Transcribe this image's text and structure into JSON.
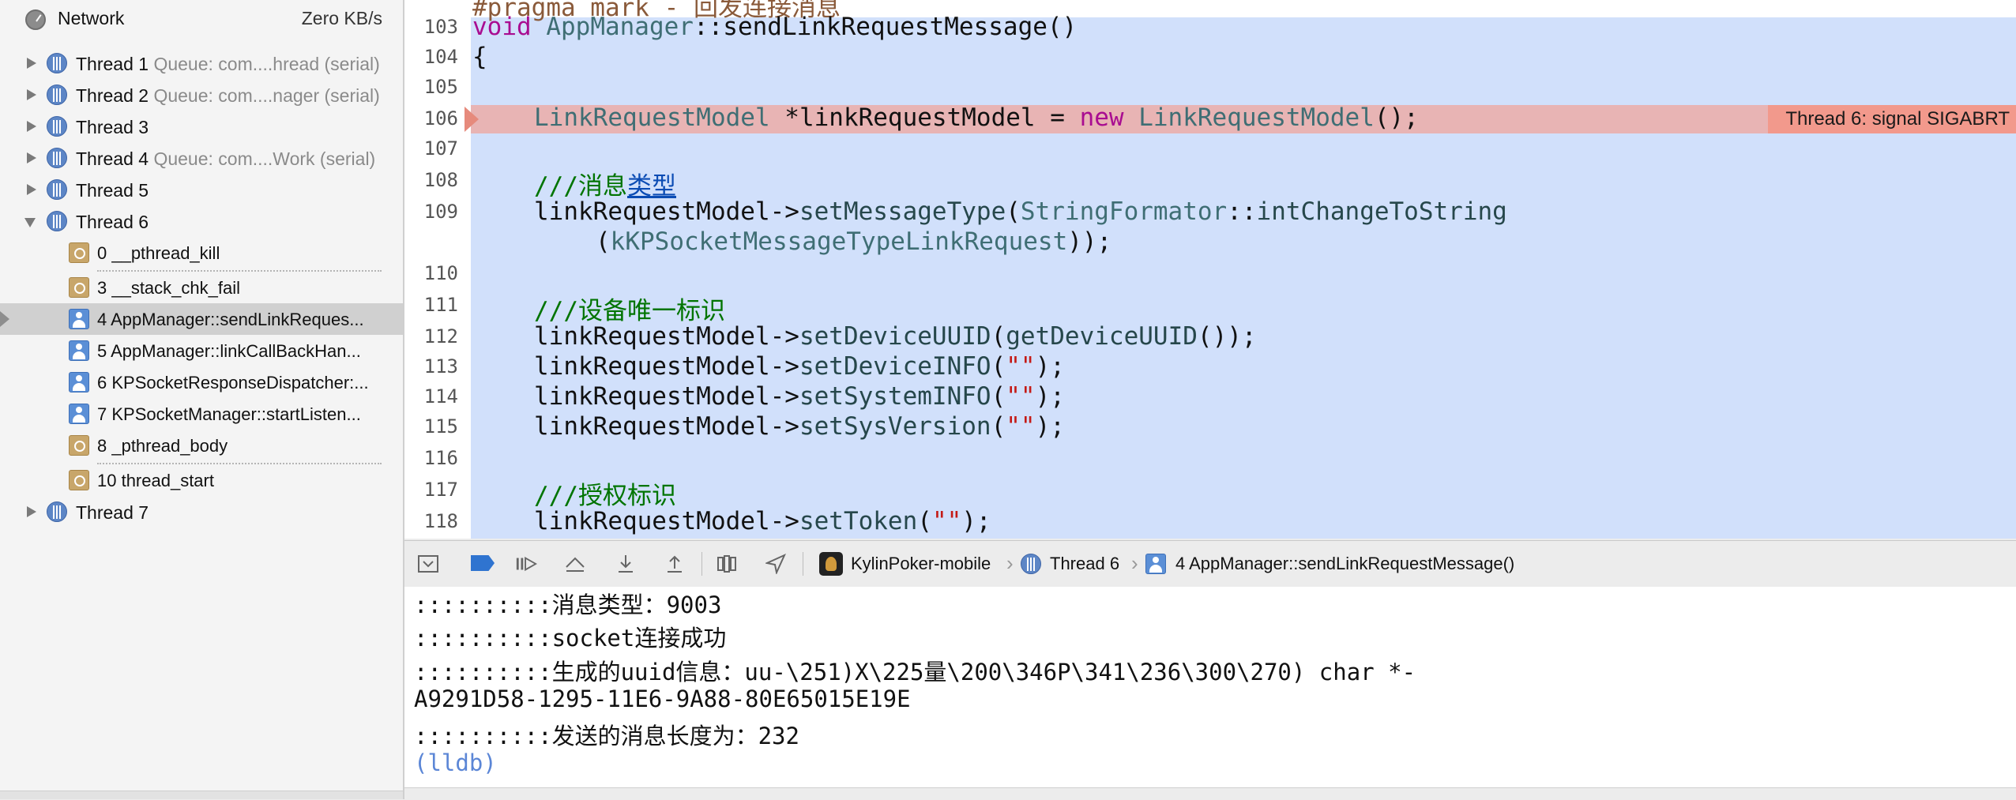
{
  "network": {
    "label": "Network",
    "value": "Zero KB/s"
  },
  "threads": [
    {
      "name": "Thread 1",
      "queue": "Queue: com....hread (serial)"
    },
    {
      "name": "Thread 2",
      "queue": "Queue: com....nager (serial)"
    },
    {
      "name": "Thread 3",
      "queue": ""
    },
    {
      "name": "Thread 4",
      "queue": "Queue: com....Work (serial)"
    },
    {
      "name": "Thread 5",
      "queue": ""
    },
    {
      "name": "Thread 6",
      "queue": ""
    }
  ],
  "frames": [
    {
      "label": "0 __pthread_kill",
      "icon": "gear-icon"
    },
    {
      "label": "3 __stack_chk_fail",
      "icon": "gear-icon"
    },
    {
      "label": "4 AppManager::sendLinkReques...",
      "icon": "user-icon",
      "selected": true
    },
    {
      "label": "5 AppManager::linkCallBackHan...",
      "icon": "user-icon"
    },
    {
      "label": "6 KPSocketResponseDispatcher:...",
      "icon": "user-icon"
    },
    {
      "label": "7 KPSocketManager::startListen...",
      "icon": "user-icon"
    },
    {
      "label": "8 _pthread_body",
      "icon": "gear-icon"
    },
    {
      "label": "10 thread_start",
      "icon": "gear-icon"
    }
  ],
  "thread7": {
    "name": "Thread 7"
  },
  "editor": {
    "top_comment": "#pragma mark - 回发连接消息",
    "line_numbers": [
      "103",
      "104",
      "105",
      "106",
      "107",
      "108",
      "109",
      "110",
      "111",
      "112",
      "113",
      "114",
      "115",
      "116",
      "117",
      "118"
    ],
    "l103": {
      "kw": "void",
      "cls": "AppManager",
      "rest": "::sendLinkRequestMessage()"
    },
    "l104": "{",
    "l106": {
      "type": "LinkRequestModel",
      "var": " *linkRequestModel = ",
      "kw": "new",
      "type2": "LinkRequestModel",
      "end": "();"
    },
    "l108": {
      "slashes": "///",
      "text": "消息",
      "link": "类型"
    },
    "l109": {
      "obj": "linkRequestModel->",
      "fn": "setMessageType",
      "open": "(",
      "cls": "StringFormator",
      "sep": "::",
      "fn2": "intChangeToString"
    },
    "l109b": {
      "open": "(",
      "const": "kKPSocketMessageTypeLinkRequest",
      "close": "));"
    },
    "l111": "///设备唯一标识",
    "l112": {
      "obj": "linkRequestModel->",
      "fn": "setDeviceUUID",
      "open": "(",
      "fn2": "getDeviceUUID",
      "close": "());"
    },
    "l113": {
      "obj": "linkRequestModel->",
      "fn": "setDeviceINFO",
      "open": "(",
      "str": "\"\"",
      "close": ");"
    },
    "l114": {
      "obj": "linkRequestModel->",
      "fn": "setSystemINFO",
      "open": "(",
      "str": "\"\"",
      "close": ");"
    },
    "l115": {
      "obj": "linkRequestModel->",
      "fn": "setSysVersion",
      "open": "(",
      "str": "\"\"",
      "close": ");"
    },
    "l117": "///授权标识",
    "l118": {
      "obj": "linkRequestModel->",
      "fn": "setToken",
      "open": "(",
      "str": "\"\"",
      "close": ");"
    },
    "error_badge": "Thread 6: signal SIGABRT"
  },
  "debugbar": {
    "app": "KylinPoker-mobile",
    "thread": "Thread 6",
    "frame": "4 AppManager::sendLinkRequestMessage()"
  },
  "console": {
    "lines": [
      "::::::::::消息类型：9003",
      "::::::::::socket连接成功",
      "::::::::::生成的uuid信息：uu-\\251)X\\225量\\200\\346P\\341\\236\\300\\270) char *-",
      "A9291D58-1295-11E6-9A88-80E65015E19E",
      "::::::::::发送的消息长度为：232"
    ],
    "prompt": "(lldb)"
  },
  "colors": {
    "highlight": "#d1e0fb",
    "error_line": "#e8b4b4",
    "error_badge": "#f2998c",
    "thread_icon": "#5d86c6"
  }
}
